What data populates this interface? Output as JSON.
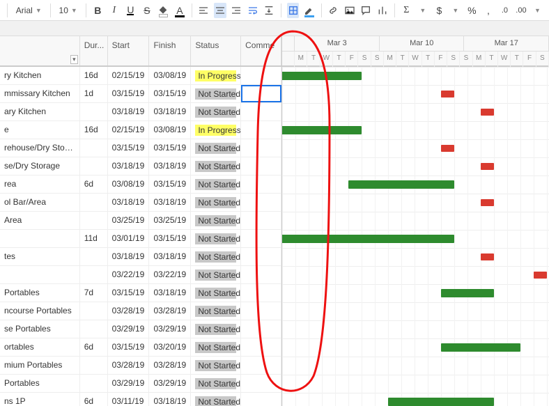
{
  "toolbar": {
    "fontName": "Arial",
    "fontSize": "10"
  },
  "columns": {
    "name": "",
    "duration": "Dur...",
    "start": "Start",
    "finish": "Finish",
    "status": "Status",
    "comments": "Comme"
  },
  "gantt": {
    "weeks": [
      "Mar 3",
      "Mar 10",
      "Mar 17"
    ],
    "days": [
      "M",
      "T",
      "W",
      "T",
      "F",
      "S",
      "S",
      "M",
      "T",
      "W",
      "T",
      "F",
      "S",
      "S",
      "M",
      "T",
      "W",
      "T",
      "F",
      "S"
    ],
    "dayWidth": 19,
    "startWeekday": 0
  },
  "statuses": {
    "inprogress": "In Progress",
    "notstarted": "Not Started"
  },
  "rows": [
    {
      "name": "ry Kitchen",
      "dur": "16d",
      "start": "02/15/19",
      "finish": "03/08/19",
      "status": "inprogress",
      "bars": [
        {
          "type": "green",
          "startDay": -7,
          "endDay": 5
        }
      ]
    },
    {
      "name": "mmissary Kitchen",
      "dur": "1d",
      "start": "03/15/19",
      "finish": "03/15/19",
      "status": "notstarted",
      "selectedComment": true,
      "bars": [
        {
          "type": "red",
          "startDay": 11,
          "endDay": 12
        }
      ]
    },
    {
      "name": "ary Kitchen",
      "dur": "",
      "start": "03/18/19",
      "finish": "03/18/19",
      "status": "notstarted",
      "bars": [
        {
          "type": "red",
          "startDay": 14,
          "endDay": 15
        }
      ]
    },
    {
      "name": "e",
      "dur": "16d",
      "start": "02/15/19",
      "finish": "03/08/19",
      "status": "inprogress",
      "bars": [
        {
          "type": "green",
          "startDay": -7,
          "endDay": 5
        }
      ]
    },
    {
      "name": "rehouse/Dry Storage",
      "dur": "",
      "start": "03/15/19",
      "finish": "03/15/19",
      "status": "notstarted",
      "bars": [
        {
          "type": "red",
          "startDay": 11,
          "endDay": 12
        }
      ]
    },
    {
      "name": "se/Dry Storage",
      "dur": "",
      "start": "03/18/19",
      "finish": "03/18/19",
      "status": "notstarted",
      "bars": [
        {
          "type": "red",
          "startDay": 14,
          "endDay": 15
        }
      ]
    },
    {
      "name": "rea",
      "dur": "6d",
      "start": "03/08/19",
      "finish": "03/15/19",
      "status": "notstarted",
      "bars": [
        {
          "type": "green",
          "startDay": 4,
          "endDay": 12
        }
      ]
    },
    {
      "name": "ol Bar/Area",
      "dur": "",
      "start": "03/18/19",
      "finish": "03/18/19",
      "status": "notstarted",
      "bars": [
        {
          "type": "red",
          "startDay": 14,
          "endDay": 15
        }
      ]
    },
    {
      "name": "Area",
      "dur": "",
      "start": "03/25/19",
      "finish": "03/25/19",
      "status": "notstarted",
      "bars": []
    },
    {
      "name": "",
      "dur": "11d",
      "start": "03/01/19",
      "finish": "03/15/19",
      "status": "notstarted",
      "bars": [
        {
          "type": "green",
          "startDay": -3,
          "endDay": 12
        }
      ]
    },
    {
      "name": "tes",
      "dur": "",
      "start": "03/18/19",
      "finish": "03/18/19",
      "status": "notstarted",
      "bars": [
        {
          "type": "red",
          "startDay": 14,
          "endDay": 15
        }
      ]
    },
    {
      "name": "",
      "dur": "",
      "start": "03/22/19",
      "finish": "03/22/19",
      "status": "notstarted",
      "bars": [
        {
          "type": "red",
          "startDay": 18,
          "endDay": 19
        }
      ]
    },
    {
      "name": " Portables",
      "dur": "7d",
      "start": "03/15/19",
      "finish": "03/18/19",
      "status": "notstarted",
      "bars": [
        {
          "type": "green",
          "startDay": 11,
          "endDay": 15
        }
      ]
    },
    {
      "name": "ncourse Portables",
      "dur": "",
      "start": "03/28/19",
      "finish": "03/28/19",
      "status": "notstarted",
      "bars": []
    },
    {
      "name": "se Portables",
      "dur": "",
      "start": "03/29/19",
      "finish": "03/29/19",
      "status": "notstarted",
      "bars": []
    },
    {
      "name": "ortables",
      "dur": "6d",
      "start": "03/15/19",
      "finish": "03/20/19",
      "status": "notstarted",
      "bars": [
        {
          "type": "green",
          "startDay": 11,
          "endDay": 17
        }
      ]
    },
    {
      "name": "mium Portables",
      "dur": "",
      "start": "03/28/19",
      "finish": "03/28/19",
      "status": "notstarted",
      "bars": []
    },
    {
      "name": " Portables",
      "dur": "",
      "start": "03/29/19",
      "finish": "03/29/19",
      "status": "notstarted",
      "bars": []
    },
    {
      "name": "ns 1P",
      "dur": "6d",
      "start": "03/11/19",
      "finish": "03/18/19",
      "status": "notstarted",
      "bars": [
        {
          "type": "green",
          "startDay": 7,
          "endDay": 15
        }
      ]
    }
  ]
}
